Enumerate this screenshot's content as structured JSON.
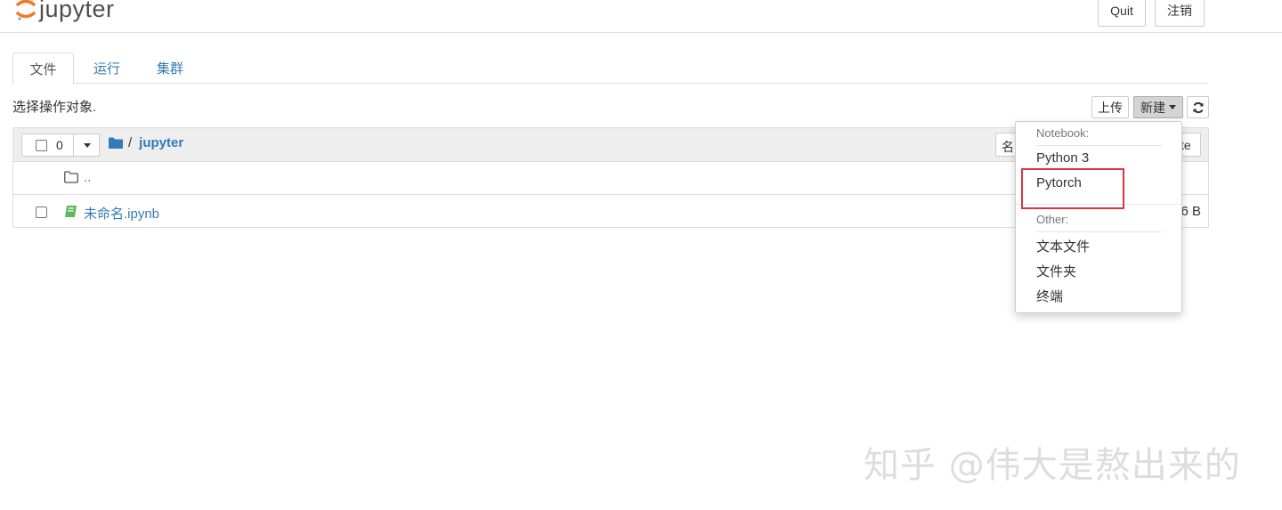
{
  "header": {
    "logo_text": "jupyter",
    "quit_label": "Quit",
    "logout_label": "注销"
  },
  "tabs": [
    {
      "label": "文件",
      "active": true
    },
    {
      "label": "运行",
      "active": false
    },
    {
      "label": "集群",
      "active": false
    }
  ],
  "toolbar": {
    "select_hint": "选择操作对象.",
    "upload_label": "上传",
    "new_label": "新建"
  },
  "file_list": {
    "selected_count": "0",
    "breadcrumb_separator": "/",
    "breadcrumb_current": "jupyter",
    "sort_name_partial": "名",
    "sort_right_partial": "te",
    "parent_dir": "..",
    "items": [
      {
        "name": "未命名.ipynb",
        "size": "6 B"
      }
    ]
  },
  "new_menu": {
    "notebook_header": "Notebook:",
    "notebook_items": [
      "Python 3",
      "Pytorch"
    ],
    "other_header": "Other:",
    "other_items": [
      "文本文件",
      "文件夹",
      "终端"
    ]
  },
  "colors": {
    "link": "#337ab7",
    "highlight_box": "#d9363e",
    "logo_orange": "#f37726"
  },
  "watermark": "知乎 @伟大是熬出来的"
}
